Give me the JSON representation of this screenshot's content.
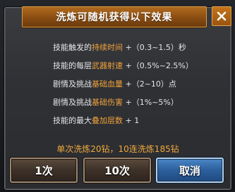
{
  "dialog": {
    "title": "洗炼可随机获得以下效果",
    "close_icon": "close-icon"
  },
  "effects": [
    {
      "pre": "技能触发的",
      "hl": "持续时间",
      "post": "+（0.3~1.5）秒"
    },
    {
      "pre": "技能的每层",
      "hl": "武器射速",
      "post": "+（0.5%~2.5%）"
    },
    {
      "pre": "剧情及挑战",
      "hl": "基础血量",
      "post": "+（2~10）点"
    },
    {
      "pre": "剧情及挑战",
      "hl": "基础伤害",
      "post": "+（1%~5%）"
    },
    {
      "pre": "技能的最大",
      "hl": "叠加层数",
      "post": "+ 1"
    }
  ],
  "cost_text": "单次洗炼20钻，10连洗炼185钻",
  "buttons": {
    "once": "1次",
    "ten": "10次",
    "cancel": "取消"
  },
  "colors": {
    "highlight": "#f2a23a",
    "title_bar": "#9a5510",
    "cancel_button": "#2c5f9c"
  }
}
